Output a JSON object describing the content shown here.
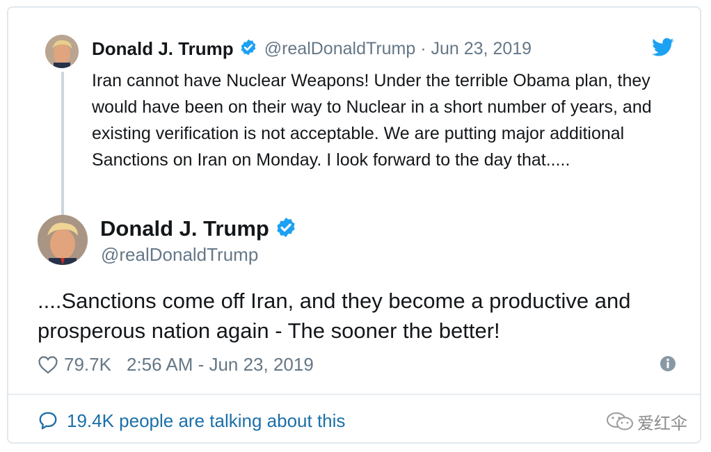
{
  "parent_tweet": {
    "author_name": "Donald J. Trump",
    "meta": "@realDonaldTrump · Jun 23, 2019",
    "text": "Iran cannot have Nuclear Weapons! Under the terrible Obama plan, they would have been on their way to Nuclear in a short number of years, and existing verification is not acceptable. We are putting major additional Sanctions on Iran on Monday. I look forward to the day that....."
  },
  "main_tweet": {
    "author_name": "Donald J. Trump",
    "handle": "@realDonaldTrump",
    "text": "....Sanctions come off Iran, and they become a productive and prosperous nation again - The sooner the better!",
    "likes": "79.7K",
    "timestamp": "2:56 AM - Jun 23, 2019"
  },
  "footer": {
    "talking_text": "19.4K people are talking about this"
  },
  "watermark": {
    "text": "爱红伞",
    "icon": "wechat-icon"
  },
  "icons": {
    "verified": "verified-badge-icon",
    "brand": "twitter-bird-icon",
    "like": "heart-icon",
    "info": "info-icon",
    "reply": "speech-bubble-icon"
  },
  "colors": {
    "verified_blue": "#1da1f2",
    "link_blue": "#1b6fa8",
    "muted_gray": "#657786",
    "border": "#e1e8ed"
  }
}
